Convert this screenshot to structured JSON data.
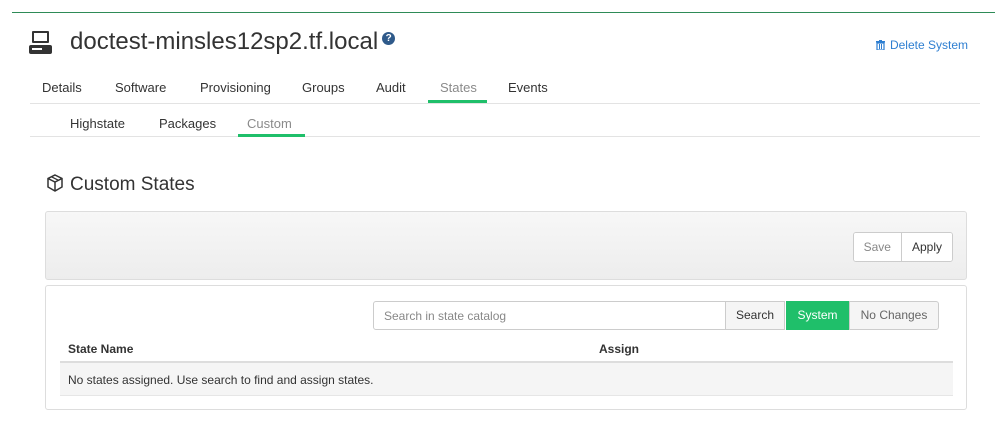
{
  "header": {
    "title": "doctest-minsles12sp2.tf.local",
    "help_icon": "question-circle-icon",
    "system_icon": "server-desktop-icon",
    "delete_label": "Delete System",
    "delete_icon": "trash-icon"
  },
  "tabs": [
    {
      "label": "Details",
      "active": false
    },
    {
      "label": "Software",
      "active": false
    },
    {
      "label": "Provisioning",
      "active": false
    },
    {
      "label": "Groups",
      "active": false
    },
    {
      "label": "Audit",
      "active": false
    },
    {
      "label": "States",
      "active": true
    },
    {
      "label": "Events",
      "active": false
    }
  ],
  "subtabs": [
    {
      "label": "Highstate",
      "active": false
    },
    {
      "label": "Packages",
      "active": false
    },
    {
      "label": "Custom",
      "active": true
    }
  ],
  "section": {
    "title": "Custom States",
    "icon": "cubes-icon"
  },
  "toolbar": {
    "save_label": "Save",
    "apply_label": "Apply"
  },
  "search": {
    "placeholder": "Search in state catalog",
    "value": "",
    "search_label": "Search",
    "system_label": "System",
    "no_changes_label": "No Changes"
  },
  "table": {
    "columns": [
      "State Name",
      "Assign"
    ],
    "empty_message": "No states assigned. Use search to find and assign states."
  },
  "colors": {
    "accent": "#1fbf6a",
    "link": "#2f7fd1",
    "help": "#2f5a8a"
  }
}
